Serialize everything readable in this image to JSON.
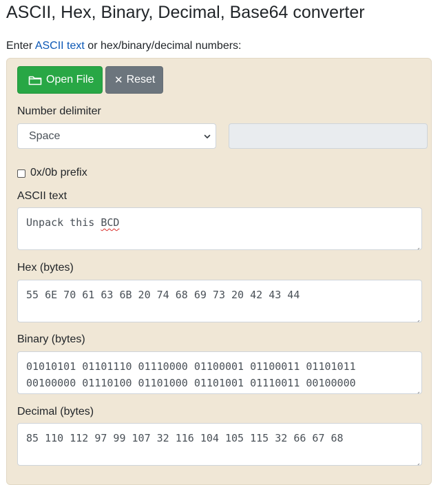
{
  "page": {
    "title": "ASCII, Hex, Binary, Decimal, Base64 converter",
    "intro_prefix": "Enter ",
    "intro_link": "ASCII text",
    "intro_suffix": " or hex/binary/decimal numbers:"
  },
  "toolbar": {
    "open_file_label": "Open File",
    "reset_label": "Reset",
    "open_icon": "folder-icon",
    "reset_icon": "close-icon"
  },
  "delimiter": {
    "label": "Number delimiter",
    "selected": "Space",
    "custom_value": ""
  },
  "prefix": {
    "label": "0x/0b prefix",
    "checked": false
  },
  "ascii": {
    "label": "ASCII text",
    "text": "Unpack this ",
    "misspelled": "BCD"
  },
  "hex": {
    "label": "Hex (bytes)",
    "value": "55 6E 70 61 63 6B 20 74 68 69 73 20 42 43 44"
  },
  "binary": {
    "label": "Binary (bytes)",
    "value": "01010101 01101110 01110000 01100001 01100011 01101011\n00100000 01110100 01101000 01101001 01110011 00100000"
  },
  "decimal": {
    "label": "Decimal (bytes)",
    "value": "85 110 112 97 99 107 32 116 104 105 115 32 66 67 68"
  },
  "colors": {
    "panel_bg": "#f0e7d6",
    "open_button": "#28a745",
    "reset_button": "#6c757d",
    "link": "#0b57b5"
  }
}
